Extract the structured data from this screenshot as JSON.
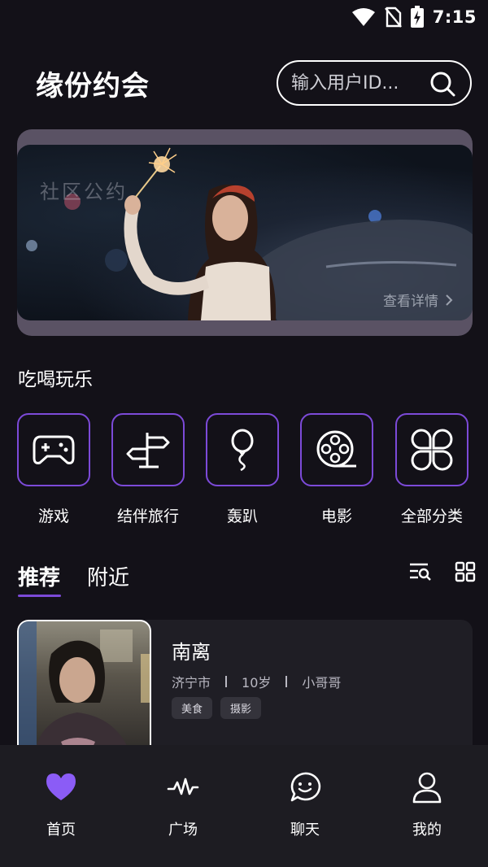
{
  "status_bar": {
    "time": "7:15"
  },
  "header": {
    "title": "缘份约会",
    "search": {
      "placeholder": "输入用户ID..."
    }
  },
  "banner": {
    "overlay_text": "社区公约",
    "more_label": "查看详情"
  },
  "section": {
    "title": "吃喝玩乐",
    "categories": [
      {
        "label": "游戏",
        "icon": "gamepad-icon"
      },
      {
        "label": "结伴旅行",
        "icon": "signpost-icon"
      },
      {
        "label": "轰趴",
        "icon": "balloon-icon"
      },
      {
        "label": "电影",
        "icon": "film-reel-icon"
      },
      {
        "label": "全部分类",
        "icon": "clover-grid-icon"
      }
    ]
  },
  "tabs": [
    {
      "label": "推荐",
      "active": true
    },
    {
      "label": "附近",
      "active": false
    }
  ],
  "card": {
    "name": "南离",
    "city": "济宁市",
    "age": "10岁",
    "role": "小哥哥",
    "tags": [
      "美食",
      "摄影"
    ]
  },
  "bottom_nav": [
    {
      "label": "首页",
      "icon": "heart-icon",
      "active": true
    },
    {
      "label": "广场",
      "icon": "pulse-icon",
      "active": false
    },
    {
      "label": "聊天",
      "icon": "chat-smile-icon",
      "active": false
    },
    {
      "label": "我的",
      "icon": "user-icon",
      "active": false
    }
  ],
  "colors": {
    "background": "#131118",
    "accent": "#7c4ad8",
    "heart": "#8b5cf6",
    "card": "#1f1e25",
    "nav": "#1d1c22"
  }
}
